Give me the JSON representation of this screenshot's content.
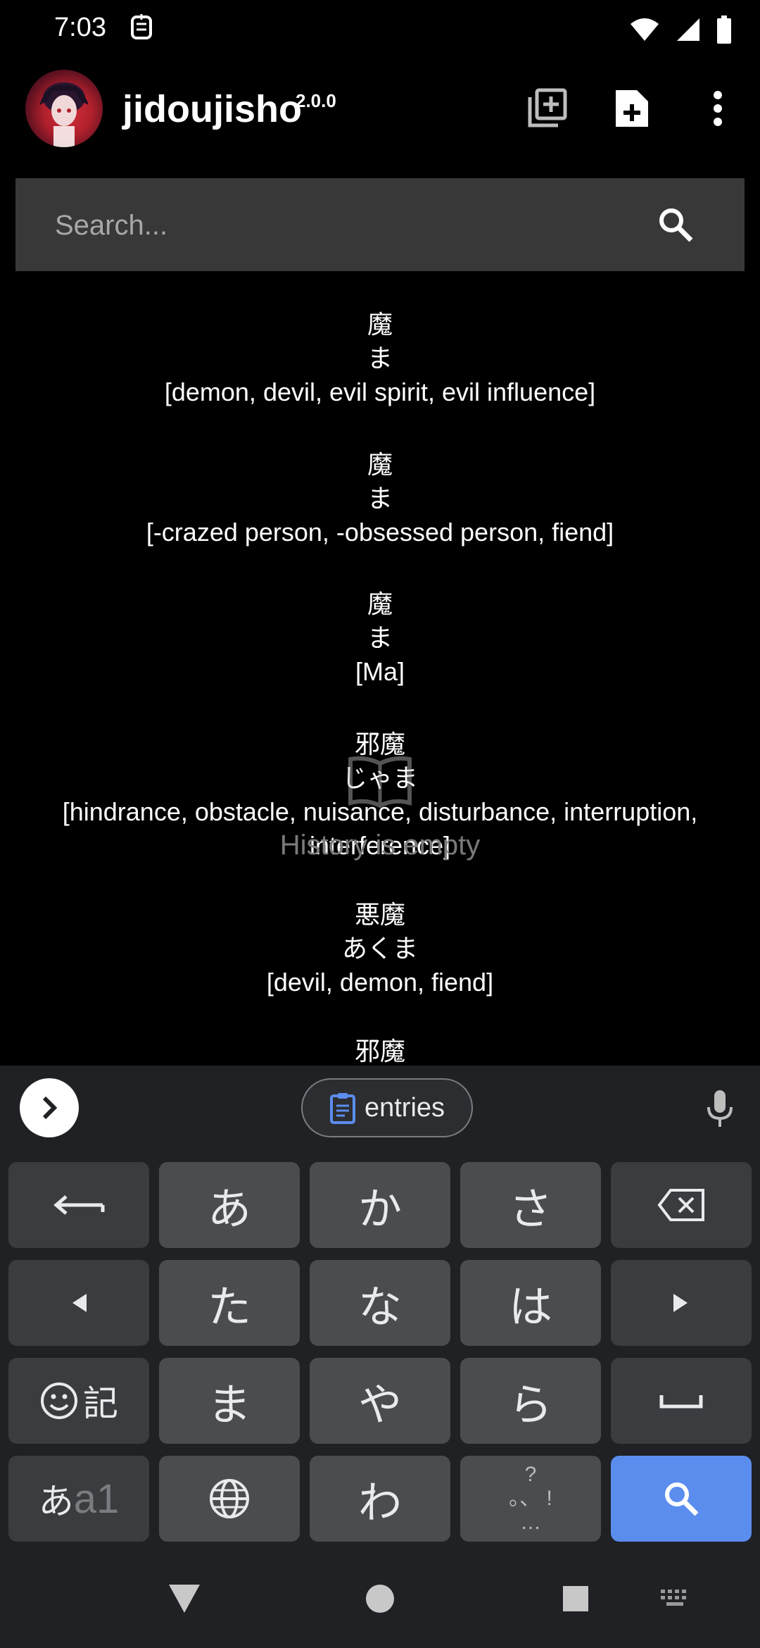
{
  "status": {
    "time": "7:03",
    "icons": [
      "app-notification-icon",
      "wifi-icon",
      "cellular-signal-icon",
      "battery-icon"
    ]
  },
  "app": {
    "title": "jidoujisho",
    "version": "2.0.0",
    "actions": [
      "add-media-icon",
      "new-document-icon",
      "more-vert-icon"
    ]
  },
  "search": {
    "placeholder": "Search...",
    "value": ""
  },
  "results": [
    {
      "word": "魔",
      "reading": "ま",
      "meaning": "[demon, devil, evil spirit, evil influence]"
    },
    {
      "word": "魔",
      "reading": "ま",
      "meaning": "[-crazed person, -obsessed person, fiend]"
    },
    {
      "word": "魔",
      "reading": "ま",
      "meaning": "[Ma]"
    },
    {
      "word": "邪魔",
      "reading": "じゃま",
      "meaning": "[hindrance, obstacle, nuisance, disturbance, interruption, interference]"
    },
    {
      "word": "悪魔",
      "reading": "あくま",
      "meaning": "[devil, demon, fiend]"
    },
    {
      "word": "邪魔",
      "reading": "",
      "meaning": ""
    }
  ],
  "empty_state": {
    "text": "History is empty",
    "icon": "book-icon"
  },
  "keyboard": {
    "clipboard_chip": "entries",
    "rows": [
      [
        "enter-back",
        "あ",
        "か",
        "さ",
        "backspace"
      ],
      [
        "cursor-left",
        "た",
        "な",
        "は",
        "cursor-right"
      ],
      [
        "emoji-symbols",
        "ま",
        "や",
        "ら",
        "space"
      ],
      [
        "mode-switch",
        "globe",
        "わ",
        "punctuation",
        "search"
      ]
    ],
    "emoji_key_label": "記",
    "mode_key_label_kana": "あ",
    "mode_key_label_alnum": "a1",
    "punct_top": "?",
    "punct_mid": "。、 !",
    "punct_bottom": "…",
    "accent_color": "#5b8def"
  },
  "nav": {
    "buttons": [
      "back-icon",
      "home-icon",
      "recents-icon",
      "keyboard-switch-icon"
    ]
  }
}
